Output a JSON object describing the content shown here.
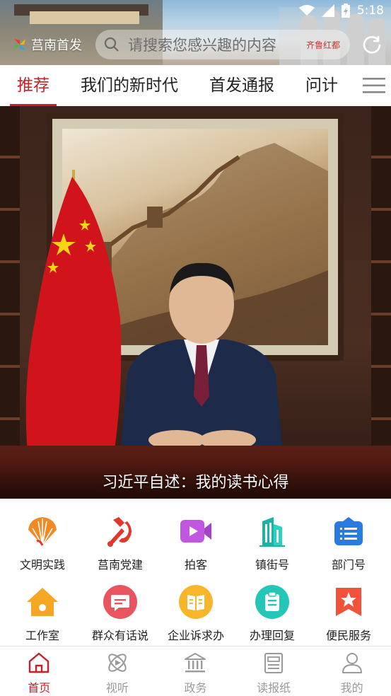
{
  "status_bar": {
    "time": "5:18"
  },
  "header": {
    "logo_text": "莒南首发",
    "search_placeholder": "请搜索您感兴趣的内容",
    "search_stamp": "齐鲁红都"
  },
  "tabs": [
    {
      "label": "推荐",
      "active": true
    },
    {
      "label": "我们的新时代",
      "active": false
    },
    {
      "label": "首发通报",
      "active": false
    },
    {
      "label": "问计",
      "active": false
    }
  ],
  "hero": {
    "caption": "习近平自述：我的读书心得"
  },
  "services": [
    {
      "label": "文明实践",
      "icon": "fan-icon"
    },
    {
      "label": "莒南党建",
      "icon": "party-emblem-icon"
    },
    {
      "label": "拍客",
      "icon": "video-camera-icon"
    },
    {
      "label": "镇街号",
      "icon": "building-icon"
    },
    {
      "label": "部门号",
      "icon": "briefcase-list-icon"
    },
    {
      "label": "工作室",
      "icon": "house-icon"
    },
    {
      "label": "群众有话说",
      "icon": "chat-icon"
    },
    {
      "label": "企业诉求办",
      "icon": "book-icon"
    },
    {
      "label": "办理回复",
      "icon": "clipboard-icon"
    },
    {
      "label": "便民服务",
      "icon": "star-bookmark-icon"
    }
  ],
  "bottom_nav": [
    {
      "label": "首页",
      "icon": "home-icon",
      "active": true
    },
    {
      "label": "视听",
      "icon": "atom-play-icon",
      "active": false
    },
    {
      "label": "政务",
      "icon": "government-building-icon",
      "active": false
    },
    {
      "label": "读报纸",
      "icon": "newspaper-icon",
      "active": false
    },
    {
      "label": "我的",
      "icon": "user-icon",
      "active": false
    }
  ],
  "colors": {
    "accent": "#cc2028",
    "nav_inactive": "#9a9a9a"
  }
}
